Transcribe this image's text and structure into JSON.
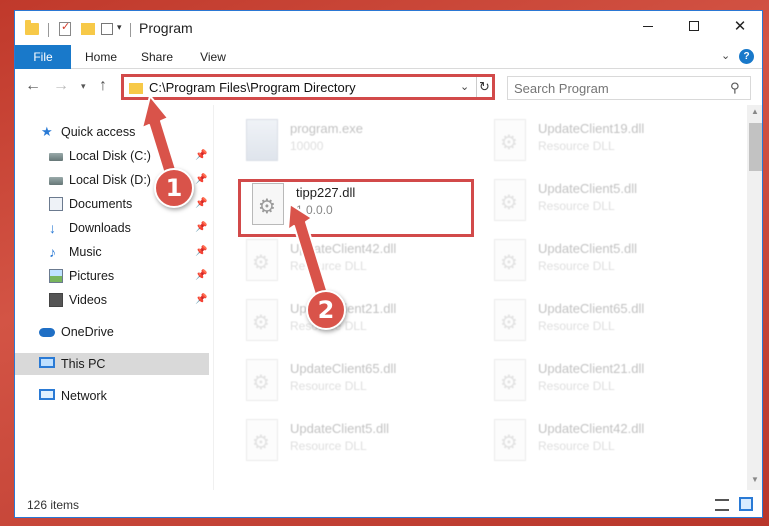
{
  "window": {
    "title": "Program",
    "controls": {
      "minimize": "",
      "maximize": "",
      "close": "✕"
    }
  },
  "ribbon": {
    "tabs": [
      "File",
      "Home",
      "Share",
      "View"
    ],
    "help": "?"
  },
  "address": {
    "path": "C:\\Program Files\\Program Directory",
    "search_placeholder": "Search Program"
  },
  "navigation": {
    "items": [
      {
        "label": "Quick access",
        "icon": "star-icon",
        "pinned": false
      },
      {
        "label": "Local Disk (C:)",
        "icon": "disk-icon",
        "pinned": true
      },
      {
        "label": "Local Disk (D:)",
        "icon": "disk-icon",
        "pinned": true
      },
      {
        "label": "Documents",
        "icon": "documents-icon",
        "pinned": true
      },
      {
        "label": "Downloads",
        "icon": "download-icon",
        "pinned": true
      },
      {
        "label": "Music",
        "icon": "music-icon",
        "pinned": true
      },
      {
        "label": "Pictures",
        "icon": "pictures-icon",
        "pinned": true
      },
      {
        "label": "Videos",
        "icon": "videos-icon",
        "pinned": true
      },
      {
        "label": "OneDrive",
        "icon": "onedrive-icon",
        "pinned": false
      },
      {
        "label": "This PC",
        "icon": "this-pc-icon",
        "pinned": false,
        "selected": true
      },
      {
        "label": "Network",
        "icon": "network-icon",
        "pinned": false
      }
    ]
  },
  "files": {
    "highlighted": {
      "name": "tipp227.dll",
      "version": "1.0.0.0"
    },
    "background": [
      {
        "name": "program.exe",
        "sub": "10000"
      },
      {
        "name": "UpdateClient19.dll",
        "sub": "Resource DLL"
      },
      {
        "name": "UpdateClient5.dll",
        "sub": "Resource DLL"
      },
      {
        "name": "UpdateClient42.dll",
        "sub": "Resource DLL"
      },
      {
        "name": "UpdateClient5.dll",
        "sub": "Resource DLL"
      },
      {
        "name": "UpdateClient21.dll",
        "sub": "Resource DLL"
      },
      {
        "name": "UpdateClient65.dll",
        "sub": "Resource DLL"
      },
      {
        "name": "UpdateClient65.dll",
        "sub": "Resource DLL"
      },
      {
        "name": "UpdateClient21.dll",
        "sub": "Resource DLL"
      },
      {
        "name": "UpdateClient5.dll",
        "sub": "Resource DLL"
      },
      {
        "name": "UpdateClient42.dll",
        "sub": "Resource DLL"
      }
    ]
  },
  "status": {
    "item_count": "126 items"
  },
  "annotations": {
    "step1": "1",
    "step2": "2"
  },
  "colors": {
    "accent": "#1979ca",
    "callout": "#d9534a",
    "highlight_border": "#d24a4a"
  }
}
